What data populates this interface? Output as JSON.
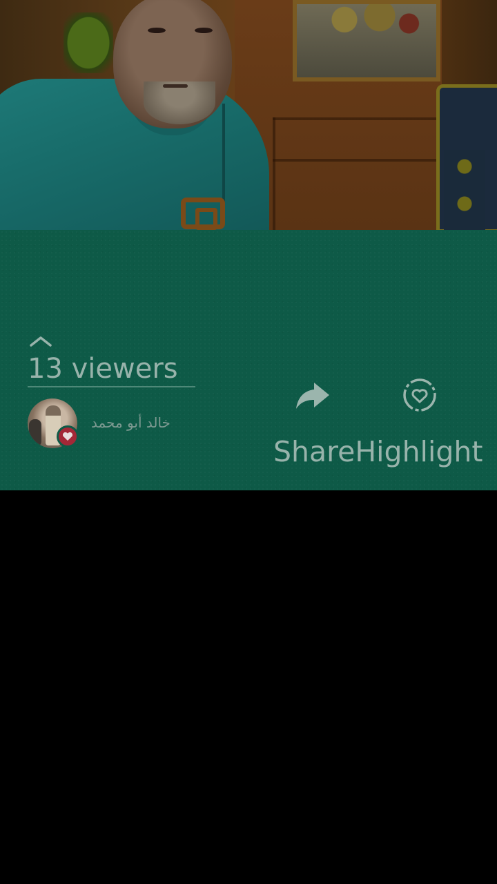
{
  "live": {
    "viewers_label": "13 viewers",
    "expand_icon": "chevron-up-icon",
    "top_viewer": {
      "name": "خالد أبو محمد",
      "badge_icon": "heart-icon"
    }
  },
  "actions": {
    "share_label": "Share",
    "share_icon": "share-arrow-icon",
    "highlight_label": "Highlight",
    "highlight_icon": "heart-circle-icon"
  },
  "colors": {
    "panel_bg": "#0e5a47",
    "text": "#98b3ab",
    "badge": "#a32837",
    "background": "#000000"
  }
}
